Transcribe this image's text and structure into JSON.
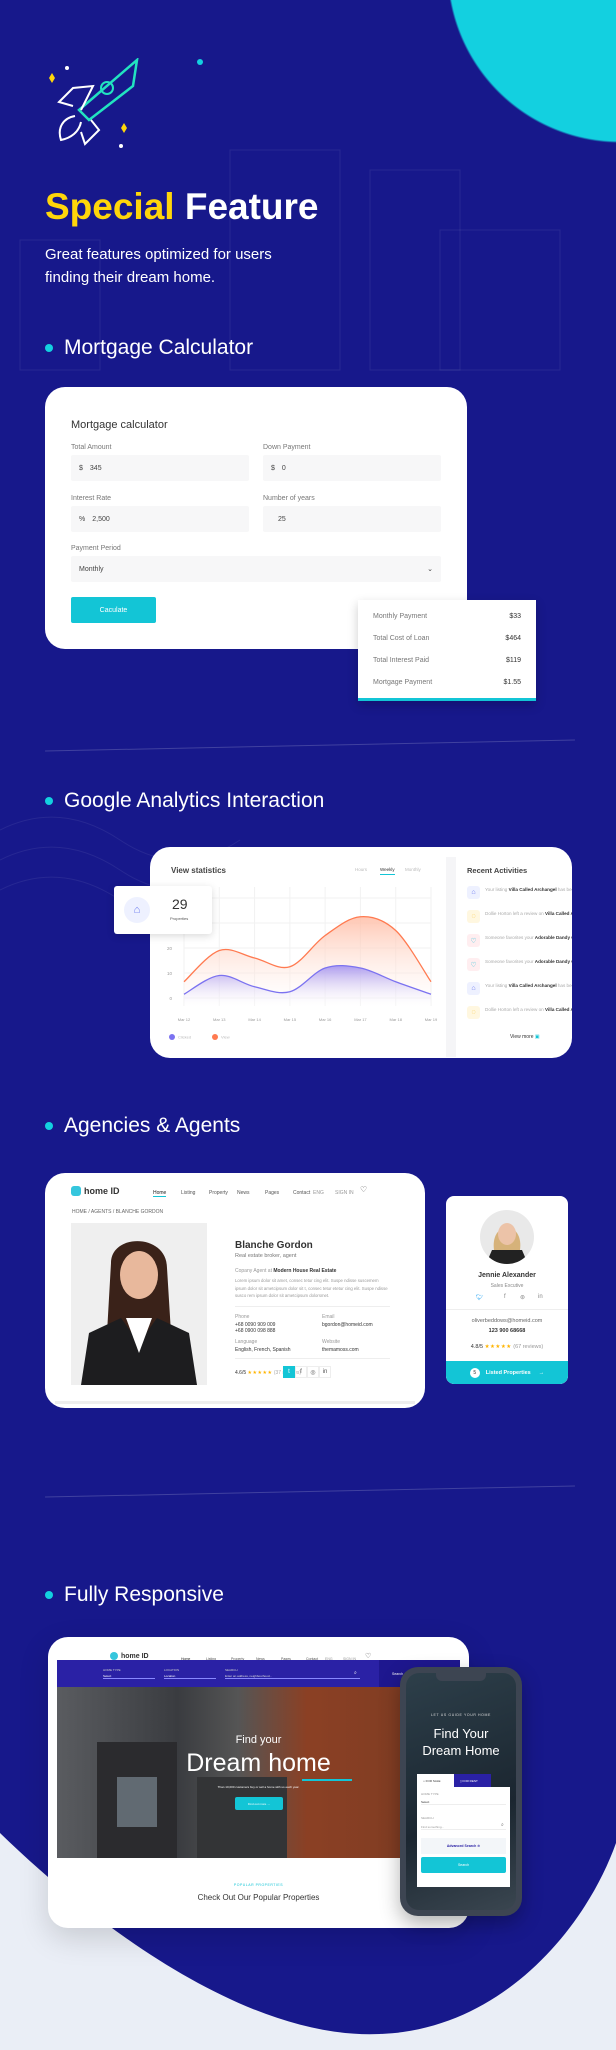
{
  "colors": {
    "background": "#17188b",
    "accent": "#13d0e0",
    "highlight": "#ffd60a",
    "bottom_bg": "#eaeef6",
    "clicked": "#7b72f0",
    "view": "#ff7a50"
  },
  "hero": {
    "title_highlight": "Special",
    "title_rest": "Feature",
    "subtitle": "Great features optimized for users finding their dream home.",
    "icon": "rocket-icon"
  },
  "sections": {
    "mortgage": "Mortgage Calculator",
    "analytics": "Google Analytics Interaction",
    "agents": "Agencies & Agents",
    "responsive": "Fully Responsive"
  },
  "mortgage": {
    "title": "Mortgage calculator",
    "fields": [
      {
        "label": "Total Amount",
        "prefix": "$",
        "value": "345"
      },
      {
        "label": "Down Payment",
        "prefix": "$",
        "value": "0"
      },
      {
        "label": "Interest Rate",
        "prefix": "%",
        "value": "2,500"
      },
      {
        "label": "Number of years",
        "prefix": "",
        "value": "25"
      }
    ],
    "period_label": "Payment Period",
    "period_value": "Monthly",
    "button": "Caculate",
    "results": [
      {
        "label": "Monthly Payment",
        "value": "$33"
      },
      {
        "label": "Total Cost of Loan",
        "value": "$464"
      },
      {
        "label": "Total Interest Paid",
        "value": "$119"
      },
      {
        "label": "Mortgage Payment",
        "value": "$1.55"
      }
    ]
  },
  "analytics": {
    "title": "View statistics",
    "tabs": [
      {
        "label": "Hours",
        "active": false
      },
      {
        "label": "Weekly",
        "active": true
      },
      {
        "label": "Monthly",
        "active": false
      }
    ],
    "stat": {
      "value": "29",
      "label": "Properties",
      "icon": "house-icon"
    },
    "activities_title": "Recent Activities",
    "activities": [
      {
        "icon": "house-icon",
        "pre": "Your listing ",
        "bold": "Villa Called Archangel",
        "post": " has been approved"
      },
      {
        "icon": "chat-icon",
        "pre": "Dollie Horton left a review on ",
        "bold": "Villa Called Archangel",
        "post": ""
      },
      {
        "icon": "heart-icon",
        "pre": "Someone favorites your ",
        "bold": "Adorable Dandy Gingerbread House",
        "post": " listing"
      },
      {
        "icon": "heart-icon",
        "pre": "Someone favorites your ",
        "bold": "Adorable Dandy Gingerbread House",
        "post": " listing"
      },
      {
        "icon": "house-icon",
        "pre": "Your listing ",
        "bold": "Villa Called Archangel",
        "post": " has been approved"
      },
      {
        "icon": "chat-icon",
        "pre": "Dollie Horton left a review on ",
        "bold": "Villa Called Archangel",
        "post": ""
      }
    ],
    "view_more": "View more"
  },
  "chart_data": {
    "type": "area",
    "categories": [
      "Mar 12",
      "Mar 13",
      "Mar 14",
      "Mar 15",
      "Mar 16",
      "Mar 17",
      "Mar 18",
      "Mar 19"
    ],
    "y_ticks": [
      "0",
      "10",
      "20"
    ],
    "ylim": [
      0,
      44
    ],
    "grid": true,
    "legend": "bottom-left",
    "series": [
      {
        "name": "Clicked",
        "values": [
          1.5,
          9,
          4.5,
          2.5,
          12,
          12,
          6.5,
          1.5
        ]
      },
      {
        "name": "View",
        "values": [
          6.5,
          19,
          16,
          12.5,
          25,
          32.5,
          27,
          6.5
        ]
      }
    ]
  },
  "agent_page": {
    "logo": "home ID",
    "nav": [
      "Home",
      "Listing",
      "Property",
      "News",
      "Pages",
      "Contact"
    ],
    "lang": "ENG",
    "signin": "SIGN IN",
    "cart_count": "1",
    "breadcrumb": "HOME / AGENTS / BLANCHE GORDON",
    "name": "Blanche Gordon",
    "role": "Real estate broker, agent",
    "company_pre": "Copany Agent at ",
    "company": "Modern House Real Estate",
    "bio": "Lorem ipsum dolor sit amet, consec tetur cing elit. Suspe ndisse suscemem ipsum dolor sit ametcipsum dolor sit t, consec tetur etetur cing elit. Suspe ndisse susco rem ipsum dolor sit ametcipsum dolorsmet.",
    "phone_label": "Phone",
    "phone1": "+68 0090 909 009",
    "phone2": "+68 0900 098 888",
    "email_label": "Email",
    "email": "bgordon@homeid.com",
    "language_label": "Language",
    "language": "English, French, Spanish",
    "website_label": "Website",
    "website": "themamoss.com",
    "rating": "4.6/5",
    "reviews": "(37 reviews)"
  },
  "agent_card": {
    "name": "Jennie Alexander",
    "role": "Sales Excutive",
    "email": "oliverbeddows@homeid.com",
    "phone": "123 900 68668",
    "rating": "4.8/5",
    "reviews": "(67 reviews)",
    "listed_count": "5",
    "listed_label": "Listed Properties"
  },
  "desktop": {
    "logo": "home ID",
    "nav": [
      "Home",
      "Listing",
      "Property",
      "News",
      "Pages",
      "Contact"
    ],
    "lang": "ENG",
    "signin": "SIGN IN",
    "search": {
      "home_type_label": "HOME TYPE",
      "home_type": "Select",
      "location_label": "LOCATION",
      "location": "Location",
      "search_label": "SEARCH",
      "placeholder": "Enter an address, neighbourhood...",
      "button": "Search"
    },
    "hero_small": "Find your",
    "hero_big": "Dream home",
    "tagline": "Than 10,000 customers buy or sell a home with us each year.",
    "cta": "Find out more",
    "popular_label": "POPULAR PROPERTIES",
    "popular_title": "Check Out Our Popular Properties"
  },
  "mobile": {
    "eyebrow": "LET US GUIDE YOUR HOME",
    "title1": "Find Your",
    "title2": "Dream Home",
    "tab_sale": "FOR SALE",
    "tab_rent": "FOR RENT",
    "home_type_label": "HOME TYPE",
    "home_type": "Select",
    "search_label": "SEARCH",
    "placeholder": "Find something...",
    "advanced": "Advanced Search",
    "button": "Search"
  }
}
